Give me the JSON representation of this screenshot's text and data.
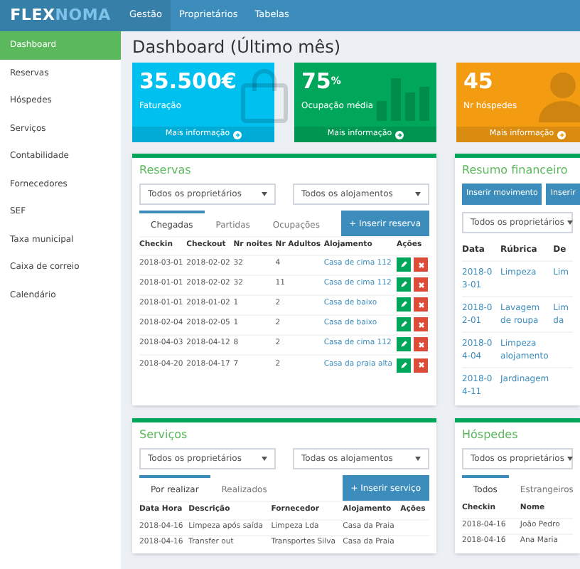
{
  "logo": {
    "part_1": "FLEX",
    "part_2": "NOMA"
  },
  "nav": [
    {
      "label": "Gestão",
      "selected": true
    },
    {
      "label": "Proprietários",
      "selected": false
    },
    {
      "label": "Tabelas",
      "selected": false
    }
  ],
  "sidebar": {
    "items": [
      {
        "label": "Dashboard",
        "selected": true
      },
      {
        "label": "Reservas",
        "selected": false
      },
      {
        "label": "Hóspedes",
        "selected": false
      },
      {
        "label": "Serviços",
        "selected": false
      },
      {
        "label": "Contabilidade",
        "selected": false
      },
      {
        "label": "Fornecedores",
        "selected": false
      },
      {
        "label": "SEF",
        "selected": false
      },
      {
        "label": "Taxa municipal",
        "selected": false
      },
      {
        "label": "Caixa de correio",
        "selected": false
      },
      {
        "label": "Calendário",
        "selected": false
      }
    ]
  },
  "title": "Dashboard (Último mês)",
  "stats": [
    {
      "value": "35.500€",
      "label": "Faturação",
      "link": "Mais informação",
      "color": "#00c0ef",
      "kind": "bag"
    },
    {
      "value": "75",
      "sup": "%",
      "label": "Ocupação média",
      "link": "Mais informação",
      "color": "#00a65a",
      "kind": "bars"
    },
    {
      "value": "45",
      "label": "Nr hóspedes",
      "link": "Mais informação",
      "color": "#f39c12",
      "kind": "person"
    }
  ],
  "reservas": {
    "title": "Reservas",
    "filters": [
      "Todos os proprietários",
      "Todos os alojamentos"
    ],
    "tabs": [
      {
        "label": "Chegadas",
        "selected": true
      },
      {
        "label": "Partidas",
        "selected": false
      },
      {
        "label": "Ocupações",
        "selected": false
      }
    ],
    "button": "+ Inserir reserva",
    "columns": [
      "Checkin",
      "Checkout",
      "Nr noites",
      "Nr Adultos",
      "Alojamento",
      "Ações"
    ],
    "rows": [
      [
        "2018-03-01",
        "2018-02-02",
        "32",
        "4",
        "Casa de cima 112"
      ],
      [
        "2018-01-01",
        "2018-02-02",
        "32",
        "11",
        "Casa de cima 112"
      ],
      [
        "2018-01-01",
        "2018-01-02",
        "1",
        "2",
        "Casa de baixo"
      ],
      [
        "2018-02-04",
        "2018-02-05",
        "1",
        "2",
        "Casa de baixo"
      ],
      [
        "2018-04-03",
        "2018-04-12",
        "8",
        "2",
        "Casa de cima 112"
      ],
      [
        "2018-04-20",
        "2018-04-17",
        "7",
        "2",
        "Casa da praia alta"
      ]
    ]
  },
  "resumo": {
    "title": "Resumo financeiro",
    "buttons": [
      "Inserir movimento",
      "Inserir"
    ],
    "filter": "Todos os proprietários",
    "columns": [
      "Data",
      "Rúbrica",
      "De"
    ],
    "rows": [
      [
        "2018-03-01",
        "Limpeza",
        "Lim"
      ],
      [
        "2018-02-01",
        "Lavagem de roupa",
        "Lim da"
      ],
      [
        "2018-04-04",
        "Limpeza alojamento",
        ""
      ],
      [
        "2018-04-11",
        "Jardinagem",
        ""
      ]
    ]
  },
  "servicos": {
    "title": "Serviços",
    "filters": [
      "Todos os proprietários",
      "Todas os alojamentos"
    ],
    "tabs": [
      {
        "label": "Por realizar",
        "selected": true
      },
      {
        "label": "Realizados",
        "selected": false
      }
    ],
    "button": "+ Inserir serviço",
    "columns": [
      "Data Hora",
      "Descrição",
      "Fornecedor",
      "Alojamento",
      "Ações"
    ],
    "rows": [
      [
        "2018-04-16",
        "Limpeza após saída",
        "Limpeza Lda",
        "Casa da Praia"
      ],
      [
        "2018-04-16",
        "Transfer out",
        "Transportes Silva",
        "Casa da Praia"
      ]
    ]
  },
  "hospedes": {
    "title": "Hóspedes",
    "filter": "Todos os proprietários",
    "tabs": [
      {
        "label": "Todos",
        "selected": true
      },
      {
        "label": "Estrangeiros",
        "selected": false
      }
    ],
    "columns": [
      "Checkin",
      "Nome"
    ],
    "rows": [
      [
        "2018-04-16",
        "João Pedro"
      ],
      [
        "2018-04-16",
        "Ana Maria"
      ]
    ]
  }
}
